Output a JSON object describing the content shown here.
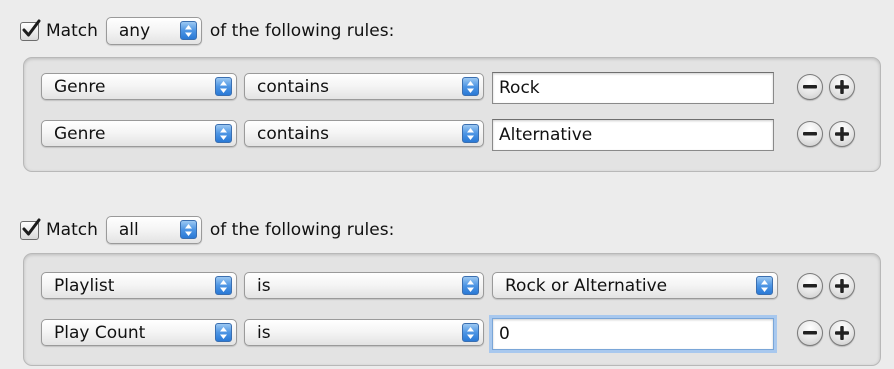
{
  "rule_sets": [
    {
      "match_enabled": true,
      "match_label": "Match",
      "match_value": "any",
      "suffix": "of the following rules:",
      "rules": [
        {
          "field": "Genre",
          "operator": "contains",
          "value": "Rock",
          "value_type": "text"
        },
        {
          "field": "Genre",
          "operator": "contains",
          "value": "Alternative",
          "value_type": "text"
        }
      ]
    },
    {
      "match_enabled": true,
      "match_label": "Match",
      "match_value": "all",
      "suffix": "of the following rules:",
      "rules": [
        {
          "field": "Playlist",
          "operator": "is",
          "value": "Rock or Alternative",
          "value_type": "popup"
        },
        {
          "field": "Play Count",
          "operator": "is",
          "value": "0",
          "value_type": "text",
          "focused": true
        }
      ]
    }
  ],
  "icons": {
    "checkbox": "checkmark-icon",
    "popup_arrows": "updown-arrows-icon",
    "remove": "minus-icon",
    "add": "plus-icon"
  }
}
